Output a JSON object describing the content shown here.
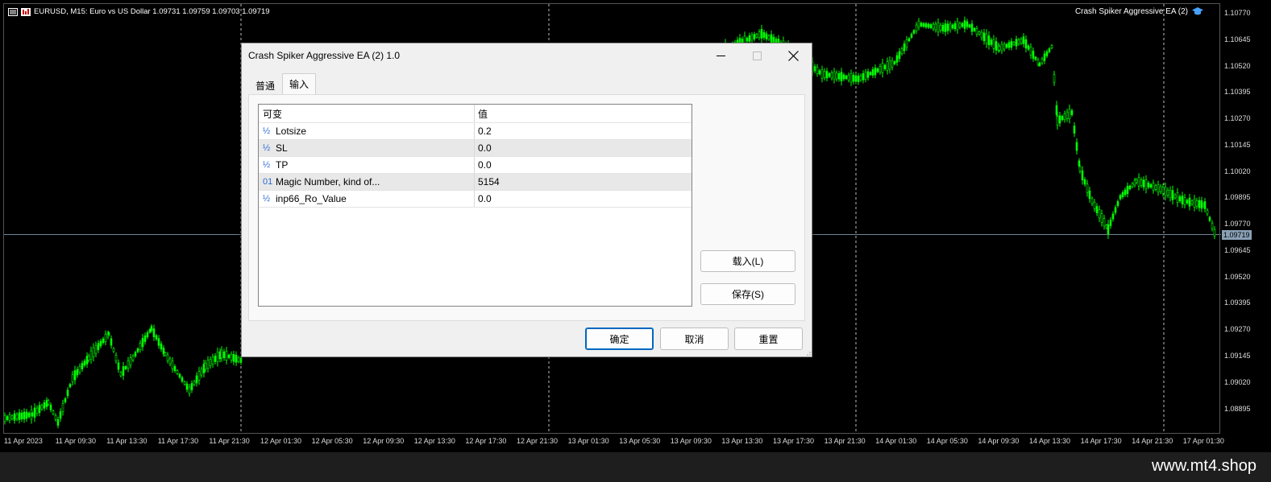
{
  "chart": {
    "symbol_line": "EURUSD, M15:  Euro vs US Dollar  1.09731 1.09759 1.09703 1.09719",
    "ea_label": "Crash Spiker Aggressive EA  (2)",
    "current_price": "1.09719",
    "price_ticks": [
      "1.10770",
      "1.10645",
      "1.10520",
      "1.10395",
      "1.10270",
      "1.10145",
      "1.10020",
      "1.09895",
      "1.09770",
      "1.09645",
      "1.09520",
      "1.09395",
      "1.09270",
      "1.09145",
      "1.09020",
      "1.08895"
    ],
    "time_ticks": [
      "11 Apr 2023",
      "11 Apr 09:30",
      "11 Apr 13:30",
      "11 Apr 17:30",
      "11 Apr 21:30",
      "12 Apr 01:30",
      "12 Apr 05:30",
      "12 Apr 09:30",
      "12 Apr 13:30",
      "12 Apr 17:30",
      "12 Apr 21:30",
      "13 Apr 01:30",
      "13 Apr 05:30",
      "13 Apr 09:30",
      "13 Apr 13:30",
      "13 Apr 17:30",
      "13 Apr 21:30",
      "14 Apr 01:30",
      "14 Apr 05:30",
      "14 Apr 09:30",
      "14 Apr 13:30",
      "14 Apr 17:30",
      "14 Apr 21:30",
      "17 Apr 01:30"
    ],
    "candle_color": "#00ff00",
    "watermark": "www.mt4.shop"
  },
  "dialog": {
    "title": "Crash Spiker Aggressive EA  (2) 1.0",
    "tabs": [
      "普通",
      "输入"
    ],
    "active_tab": "输入",
    "table": {
      "headers": [
        "可变",
        "值"
      ],
      "rows": [
        {
          "type": "½",
          "name": "Lotsize",
          "value": "0.2"
        },
        {
          "type": "½",
          "name": "SL",
          "value": "0.0"
        },
        {
          "type": "½",
          "name": "TP",
          "value": "0.0"
        },
        {
          "type": "01",
          "name": "Magic Number, kind of...",
          "value": "5154"
        },
        {
          "type": "½",
          "name": "inp66_Ro_Value",
          "value": "0.0"
        }
      ]
    },
    "load_button": "载入(L)",
    "save_button": "保存(S)",
    "ok_button": "确定",
    "cancel_button": "取消",
    "reset_button": "重置"
  }
}
